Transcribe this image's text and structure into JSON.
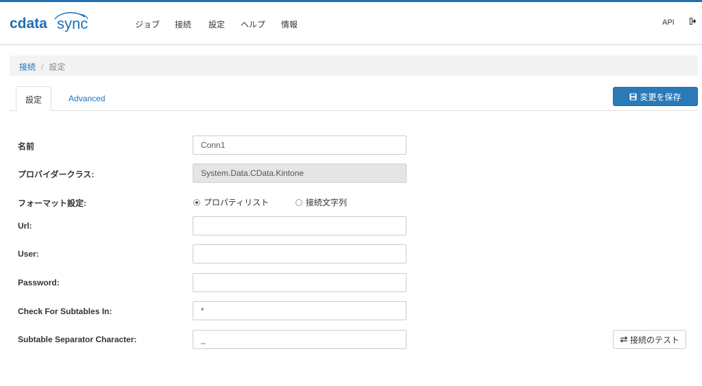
{
  "brand": {
    "name_part1": "cdata",
    "name_part2": "sync",
    "color": "#1f6fb3"
  },
  "nav": {
    "items": [
      {
        "label": "ジョブ"
      },
      {
        "label": "接続"
      },
      {
        "label": "設定"
      },
      {
        "label": "ヘルプ"
      },
      {
        "label": "情報"
      }
    ],
    "api_label": "API",
    "logout_icon": "sign-out-icon"
  },
  "breadcrumb": {
    "link": "接続",
    "separator": "/",
    "current": "設定"
  },
  "tabs": [
    {
      "label": "設定",
      "active": true
    },
    {
      "label": "Advanced",
      "active": false
    }
  ],
  "toolbar": {
    "save_label": "変更を保存",
    "save_icon": "floppy-disk-icon",
    "save_color": "#2a7ab8"
  },
  "form": {
    "name": {
      "label": "名前",
      "value": "Conn1"
    },
    "provider_class": {
      "label": "プロバイダークラス:",
      "value": "System.Data.CData.Kintone"
    },
    "format": {
      "label": "フォーマット設定:",
      "options": [
        {
          "label": "プロパティリスト",
          "checked": true
        },
        {
          "label": "接続文字列",
          "checked": false
        }
      ]
    },
    "url": {
      "label": "Url:",
      "value": ""
    },
    "user": {
      "label": "User:",
      "value": ""
    },
    "password": {
      "label": "Password:",
      "value": ""
    },
    "subtables": {
      "label": "Check For Subtables In:",
      "value": "*"
    },
    "separator": {
      "label": "Subtable Separator Character:",
      "value": "_"
    }
  },
  "test_button": {
    "label": "接続のテスト",
    "icon": "exchange-arrows-icon"
  }
}
